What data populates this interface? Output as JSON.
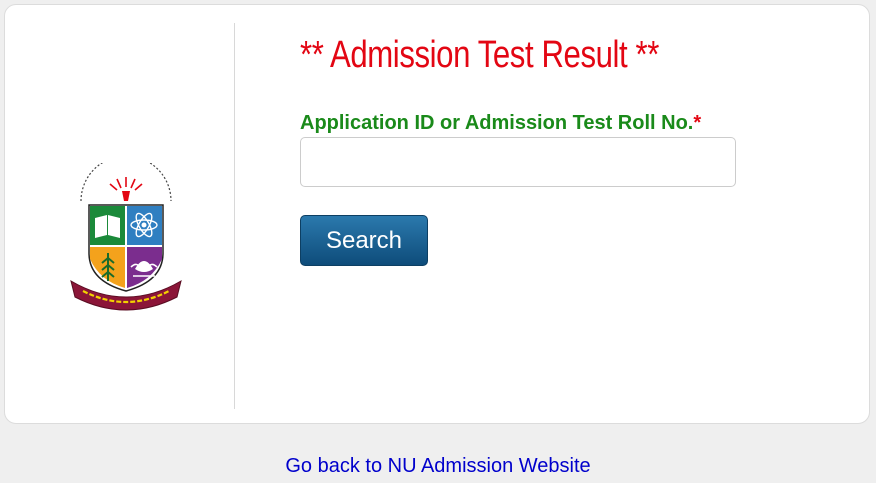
{
  "page": {
    "title": "** Admission Test Result **",
    "field_label": "Application ID or Admission Test Roll No.",
    "required_marker": "*",
    "search_input": {
      "value": "",
      "placeholder": ""
    },
    "search_button": "Search",
    "back_link": "Go back to NU Admission Website"
  },
  "logo": {
    "icon": "national-university-crest-icon",
    "arc_text": "সকল জাতির উপরে জ্ঞানের মশাল",
    "banner_text": "জাতীয় বিশ্ববিদ্যালয়"
  },
  "colors": {
    "title": "#e30613",
    "label": "#1a8a1a",
    "button": "#1a5f8f",
    "link": "#0000cc"
  }
}
